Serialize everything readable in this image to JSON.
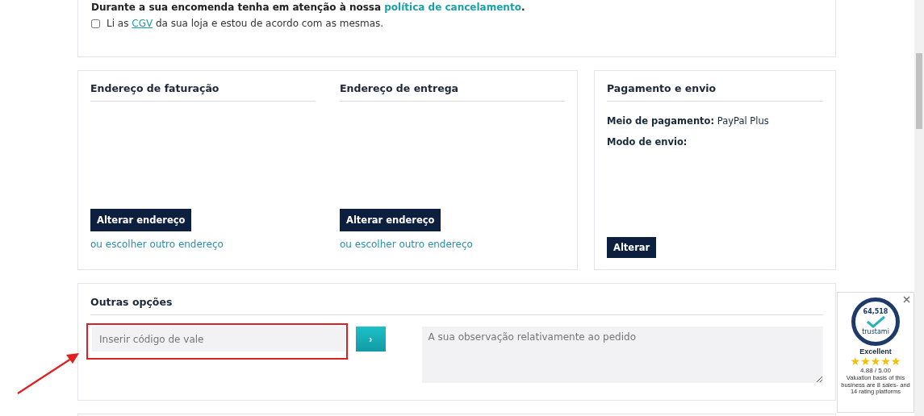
{
  "notice": {
    "text": "Durante a sua encomenda tenha em atenção à nossa ",
    "link": "política de cancelamento",
    "end": "."
  },
  "terms": {
    "checked": false,
    "before": "Li as ",
    "link": "CGV",
    "after": " da sua loja e estou de acordo com as mesmas."
  },
  "addresses": [
    {
      "title": "Endereço de faturação",
      "button": "Alterar endereço",
      "link": "ou escolher outro endereço"
    },
    {
      "title": "Endereço de entrega",
      "button": "Alterar endereço",
      "link": "ou escolher outro endereço"
    }
  ],
  "payment": {
    "title": "Pagamento e envio",
    "method_label": "Meio de pagamento:",
    "method_value": "PayPal Plus",
    "shipping_label": "Modo de envio:",
    "button": "Alterar"
  },
  "other_options": {
    "title": "Outras opções",
    "voucher_placeholder": "Inserir código de vale",
    "submit_icon": "›",
    "comment_placeholder": "A sua observação relativamente ao pedido"
  },
  "trust_widget": {
    "count": "64,518",
    "brand": "trustami",
    "rating_word": "Excellent",
    "stars": 5,
    "score": "4.88 / 5.00",
    "note": "Valuation basis of this business are 8 sales- and 14 rating platforms"
  }
}
